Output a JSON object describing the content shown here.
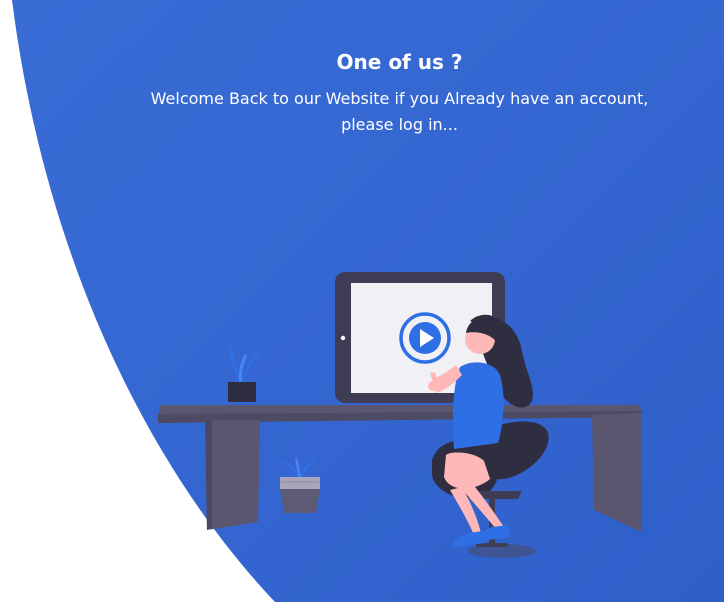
{
  "panel": {
    "title": "One of us ?",
    "message": "Welcome Back to our Website if you Already have an account, please log in..."
  },
  "illustration": {
    "name": "person-watching-video-at-desk",
    "icons": [
      "play-button-icon",
      "plant-icon"
    ]
  },
  "colors": {
    "panel_blue": "#3567d2",
    "background": "#ffffff",
    "desk": "#5a5670",
    "accent": "#2f6fe6"
  }
}
